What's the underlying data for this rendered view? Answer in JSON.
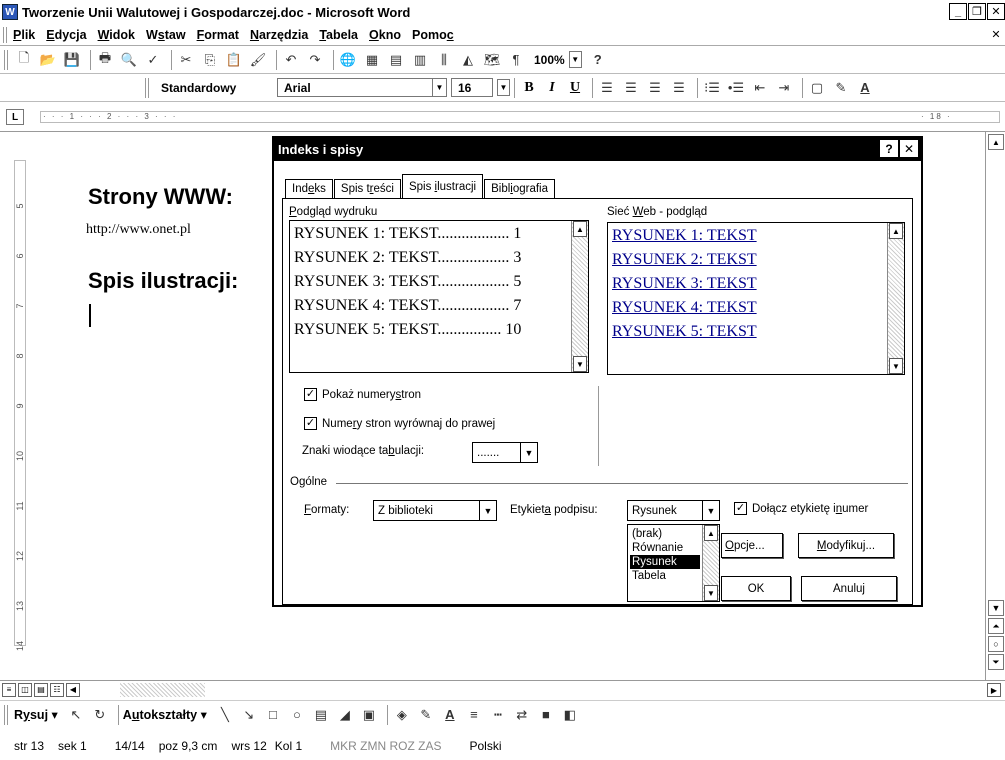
{
  "window": {
    "title": "Tworzenie Unii Walutowej i Gospodarczej.doc - Microsoft Word",
    "icon_label": "W",
    "controls": [
      "_",
      "ᗝ",
      "×"
    ]
  },
  "menubar": {
    "items": [
      {
        "pre": "",
        "acc": "P",
        "post": "lik"
      },
      {
        "pre": "",
        "acc": "E",
        "post": "dycja"
      },
      {
        "pre": "",
        "acc": "W",
        "post": "idok"
      },
      {
        "pre": "W",
        "acc": "s",
        "post": "taw"
      },
      {
        "pre": "",
        "acc": "F",
        "post": "ormat"
      },
      {
        "pre": "",
        "acc": "N",
        "post": "arzędzia"
      },
      {
        "pre": "",
        "acc": "T",
        "post": "abela"
      },
      {
        "pre": "",
        "acc": "O",
        "post": "kno"
      },
      {
        "pre": "Pomo",
        "acc": "c",
        "post": ""
      }
    ],
    "close_doc": "×"
  },
  "standard_toolbar": {
    "zoom": "100%",
    "help": "?"
  },
  "format_toolbar": {
    "style": "Standardowy",
    "font": "Arial",
    "size": "16",
    "bold": "B",
    "italic": "I",
    "underline": "U"
  },
  "ruler": {
    "corner": "L",
    "marks": "· · · 1 · · · 2 · · · 3 · · ·",
    "right_mark": "· 18 ·",
    "vertical_marks": [
      "5",
      "6",
      "7",
      "8",
      "9",
      "10",
      "11",
      "12",
      "13",
      "14"
    ]
  },
  "document": {
    "heading1": "Strony WWW:",
    "url": "http://www.onet.pl",
    "heading2": "Spis ilustracji:"
  },
  "dialog": {
    "title": "Indeks i spisy",
    "title_help": "?",
    "title_close": "×",
    "tabs": [
      {
        "pre": "Ind",
        "acc": "e",
        "post": "ks"
      },
      {
        "pre": "Spis t",
        "acc": "r",
        "post": "eści"
      },
      {
        "pre": "Spis ",
        "acc": "i",
        "post": "lustracji"
      },
      {
        "pre": "Bibl",
        "acc": "i",
        "post": "ografia"
      }
    ],
    "print_preview": {
      "label_pre": "",
      "label_acc": "P",
      "label_post": "odgląd wydruku",
      "lines": [
        {
          "text": "RYSUNEK 1: TEKST",
          "dots": "..................",
          "page": "1"
        },
        {
          "text": "RYSUNEK 2: TEKST",
          "dots": "..................",
          "page": "3"
        },
        {
          "text": "RYSUNEK 3: TEKST",
          "dots": "..................",
          "page": "5"
        },
        {
          "text": "RYSUNEK 4: TEKST",
          "dots": "..................",
          "page": "7"
        },
        {
          "text": "RYSUNEK 5: TEKST",
          "dots": "................",
          "page": "10"
        }
      ]
    },
    "web_preview": {
      "label_pre": "Sieć ",
      "label_acc": "W",
      "label_post": "eb - podgląd",
      "lines": [
        "RYSUNEK 1: TEKST",
        "RYSUNEK 2: TEKST",
        "RYSUNEK 3: TEKST",
        "RYSUNEK 4: TEKST",
        "RYSUNEK 5: TEKST"
      ]
    },
    "show_page_numbers": {
      "pre": "Pokaż numery ",
      "acc": "s",
      "post": "tron",
      "checked": "✓"
    },
    "right_align": {
      "pre": "Nume",
      "acc": "r",
      "post": "y stron wyrównaj do prawej",
      "checked": "✓"
    },
    "tab_leader": {
      "pre": "Znaki wiodące ta",
      "acc": "b",
      "post": "ulacji:",
      "value": "......."
    },
    "general_label": "Ogólne",
    "formats": {
      "pre": "",
      "acc": "F",
      "post": "ormaty:",
      "value": "Z biblioteki"
    },
    "caption_label": {
      "pre": "Etykiet",
      "acc": "a",
      "post": " podpisu:",
      "value": "Rysunek"
    },
    "include_label": {
      "pre": "Dołącz etykietę i ",
      "acc": "n",
      "post": "umer",
      "checked": "✓"
    },
    "dropdown_options": [
      "(brak)",
      "Równanie",
      "Rysunek",
      "Tabela"
    ],
    "dropdown_selected": "Rysunek",
    "buttons": {
      "options": {
        "pre": "",
        "acc": "O",
        "post": "pcje..."
      },
      "modify": {
        "pre": "",
        "acc": "M",
        "post": "odyfikuj..."
      },
      "ok": "OK",
      "cancel": "Anuluj"
    }
  },
  "draw_toolbar": {
    "draw": {
      "pre": "R",
      "acc": "y",
      "post": "suj"
    },
    "autoshapes": {
      "pre": "A",
      "acc": "u",
      "post": "tokształty"
    }
  },
  "statusbar": {
    "page": "str 13",
    "section": "sek 1",
    "pages": "14/14",
    "position": "poz 9,3 cm",
    "line": "wrs 12",
    "column": "Kol 1",
    "modes": "MKR  ZMN  ROZ  ZAS",
    "language": "Polski"
  }
}
